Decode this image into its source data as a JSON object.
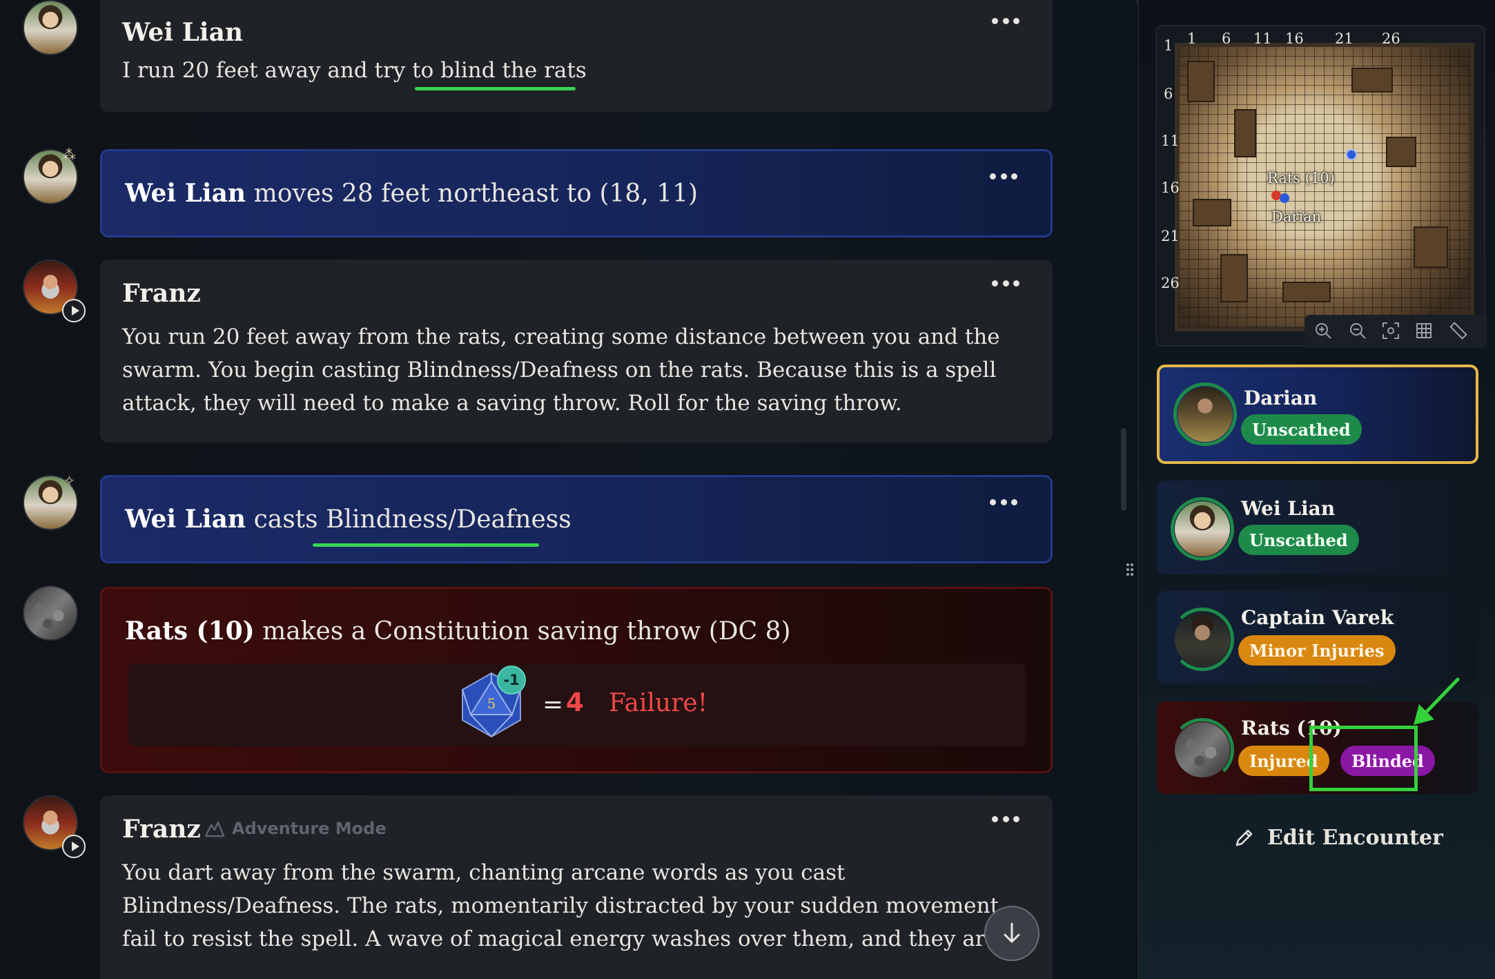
{
  "chat": {
    "messages": [
      {
        "author": "Wei Lian",
        "text_before": "I run 20 feet away and try to ",
        "text_link": "blind the rats"
      },
      {
        "actor": "Wei Lian",
        "action": "moves 28 feet northeast to (18, 11)"
      },
      {
        "author": "Franz",
        "text": "You run 20 feet away from the rats, creating some distance between you and the swarm. You begin casting Blindness/Deafness on the rats. Because this is a spell attack, they will need to make a saving throw. Roll for the saving throw."
      },
      {
        "actor": "Wei Lian",
        "action": "casts",
        "spell": "Blindness/Deafness"
      },
      {
        "actor": "Rats (10)",
        "action": "makes a Constitution saving throw (DC 8)",
        "roll": {
          "die_value": "5",
          "modifier": "-1",
          "equals": "=",
          "total": "4",
          "result": "Failure!"
        }
      },
      {
        "author": "Franz",
        "mode": "Adventure Mode",
        "text": "You dart away from the swarm, chanting arcane words as you cast Blindness/Deafness. The rats, momentarily distracted by your sudden movement, fail to resist the spell. A wave of magical energy washes over them, and they are"
      }
    ]
  },
  "map": {
    "ruler_x": [
      "1",
      "6",
      "11",
      "16",
      "21",
      "26"
    ],
    "ruler_y": [
      "1",
      "6",
      "11",
      "16",
      "21",
      "26"
    ],
    "tokens": [
      {
        "label": "Rats (10)"
      },
      {
        "label": "Darian"
      }
    ]
  },
  "encounter": {
    "combatants": [
      {
        "name": "Darian",
        "status": [
          "Unscathed"
        ],
        "active": true
      },
      {
        "name": "Wei Lian",
        "status": [
          "Unscathed"
        ]
      },
      {
        "name": "Captain Varek",
        "status": [
          "Minor Injuries"
        ]
      },
      {
        "name": "Rats (10)",
        "status": [
          "Injured",
          "Blinded"
        ],
        "enemy": true
      }
    ],
    "edit_label": "Edit Encounter"
  },
  "colors": {
    "accent_green": "#39d353",
    "failure_red": "#f04848",
    "status_unscathed": "#1e8a4a",
    "status_injured": "#d9870f",
    "status_blinded": "#8b17a5",
    "active_border": "#e6b84a"
  },
  "icons": [
    "more-options-icon",
    "play-icon",
    "footsteps-icon",
    "magic-wand-icon",
    "d20-die-icon",
    "mountain-icon",
    "arrow-down-icon",
    "zoom-in-icon",
    "zoom-out-icon",
    "fit-screen-icon",
    "grid-icon",
    "ruler-icon",
    "pencil-icon"
  ]
}
